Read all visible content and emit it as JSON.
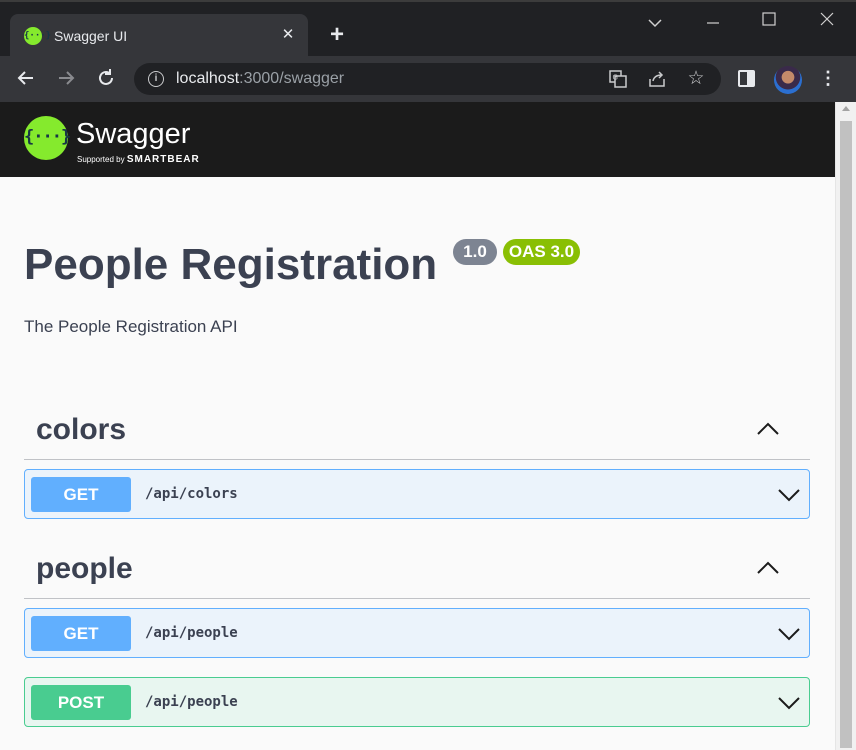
{
  "browser": {
    "tab_title": "Swagger UI",
    "tab_favicon": "{···}",
    "tab_close": "✕",
    "new_tab": "+",
    "url_host": "localhost",
    "url_rest": ":3000/swagger",
    "icons": [
      "back-arrow-icon",
      "forward-arrow-icon",
      "reload-icon",
      "info-icon",
      "translate-icon",
      "share-icon",
      "star-icon",
      "side-panel-icon",
      "profile-avatar",
      "kebab-menu-icon"
    ]
  },
  "swagger": {
    "brand": "Swagger",
    "supported_by": "Supported by",
    "smartbear": "SMARTBEAR",
    "logo_glyph": "{···}",
    "brand_color": "#85ea2d"
  },
  "info": {
    "title": "People Registration",
    "version": "1.0",
    "oas": "OAS 3.0",
    "description": "The People Registration API"
  },
  "sections": [
    {
      "name": "colors",
      "operations": [
        {
          "method": "GET",
          "path": "/api/colors",
          "color": "#61affe"
        }
      ]
    },
    {
      "name": "people",
      "operations": [
        {
          "method": "GET",
          "path": "/api/people",
          "color": "#61affe"
        },
        {
          "method": "POST",
          "path": "/api/people",
          "color": "#49cc90"
        }
      ]
    }
  ]
}
